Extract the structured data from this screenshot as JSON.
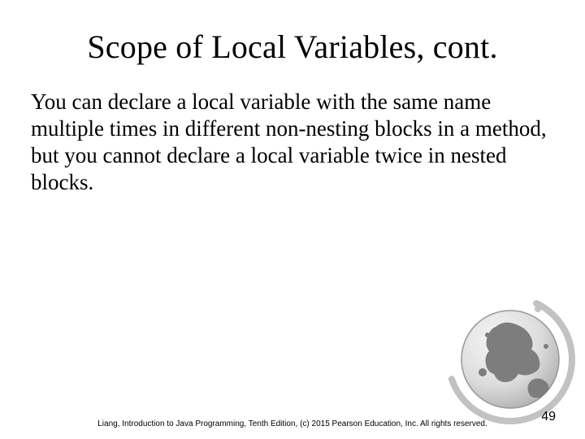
{
  "slide": {
    "title": "Scope of Local Variables, cont.",
    "body": "You can declare a local variable with the same name multiple times in different non-nesting blocks in a method, but you cannot declare a local variable twice in nested blocks.",
    "footer": "Liang, Introduction to Java Programming, Tenth Edition, (c) 2015 Pearson Education, Inc. All rights reserved.",
    "page_number": "49"
  },
  "decor": {
    "globe_icon": "globe-icon"
  }
}
